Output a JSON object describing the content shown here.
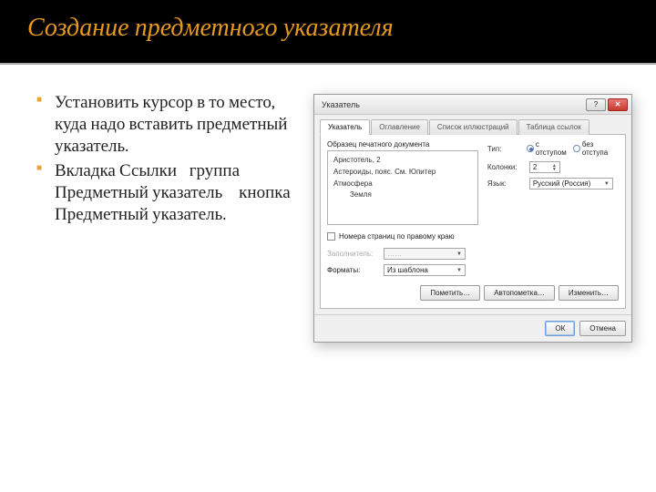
{
  "slide": {
    "title": "Создание предметного указателя",
    "bullets": [
      "Установить курсор в то место, куда надо вставить предметный указатель.",
      "Вкладка Ссылки  группа Предметный указатель   кнопка Предметный указатель."
    ]
  },
  "dialog": {
    "title": "Указатель",
    "tabs": [
      "Указатель",
      "Оглавление",
      "Список иллюстраций",
      "Таблица ссылок"
    ],
    "preview_label": "Образец печатного документа",
    "preview_items": {
      "line1": "Аристотель, 2",
      "line2": "Астероиды, пояс. См. Юпитер",
      "line3": "Атмосфера",
      "sub": "Земля"
    },
    "type_label": "Тип:",
    "radio_indent": "с отступом",
    "radio_noindent": "без отступа",
    "columns_label": "Колонки:",
    "columns_value": "2",
    "lang_label": "Язык:",
    "lang_value": "Русский (Россия)",
    "check_rightalign": "Номера страниц по правому краю",
    "fill_label": "Заполнитель:",
    "fill_value": "……",
    "format_label": "Форматы:",
    "format_value": "Из шаблона",
    "btn_mark": "Пометить…",
    "btn_automark": "Автопометка…",
    "btn_modify": "Изменить…",
    "btn_ok": "ОК",
    "btn_cancel": "Отмена"
  }
}
